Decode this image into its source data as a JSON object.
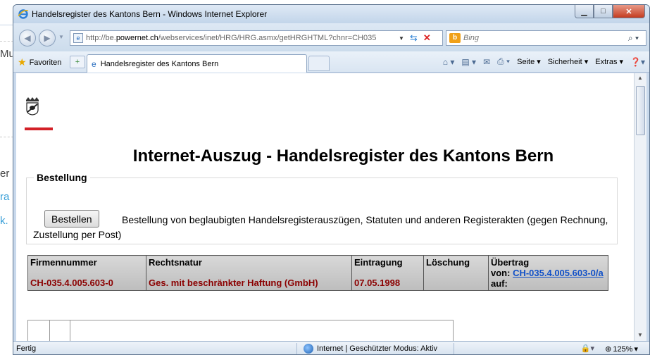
{
  "background": {
    "fragments": [
      "Mu",
      "er",
      "ra",
      "k."
    ]
  },
  "window": {
    "title": "Handelsregister des Kantons Bern - Windows Internet Explorer"
  },
  "address_bar": {
    "url_prefix": "http://be.",
    "url_domain": "powernet.ch",
    "url_rest": "/webservices/inet/HRG/HRG.asmx/getHRGHTML?chnr=CH035"
  },
  "search": {
    "placeholder": "Bing"
  },
  "favorites": {
    "label": "Favoriten"
  },
  "tab": {
    "label": "Handelsregister des Kantons Bern"
  },
  "command_bar": {
    "page": "Seite",
    "safety": "Sicherheit",
    "tools": "Extras"
  },
  "page": {
    "title": "Internet-Auszug - Handelsregister des Kantons Bern",
    "order": {
      "legend": "Bestellung",
      "button": "Bestellen",
      "description": "Bestellung von beglaubigten Handelsregisterauszügen, Statuten und anderen Registerakten (gegen Rechnung, Zustellung per Post)"
    },
    "table": {
      "headers": [
        "Firmennummer",
        "Rechtsnatur",
        "Eintragung",
        "Löschung",
        "Übertrag"
      ],
      "transfer_from_label": "von:",
      "transfer_from_link": "CH-035.4.005.603-0/a",
      "transfer_to_label": "auf:",
      "row": {
        "firmennummer": "CH-035.4.005.603-0",
        "rechtsnatur": "Ges. mit beschränkter Haftung (GmbH)",
        "eintragung": "07.05.1998",
        "loeschung": ""
      }
    }
  },
  "status_bar": {
    "status": "Fertig",
    "zone": "Internet | Geschützter Modus: Aktiv",
    "zoom": "125%"
  },
  "colors": {
    "accent_red": "#d32027",
    "value_red": "#8b0000",
    "link_blue": "#1050c8"
  }
}
